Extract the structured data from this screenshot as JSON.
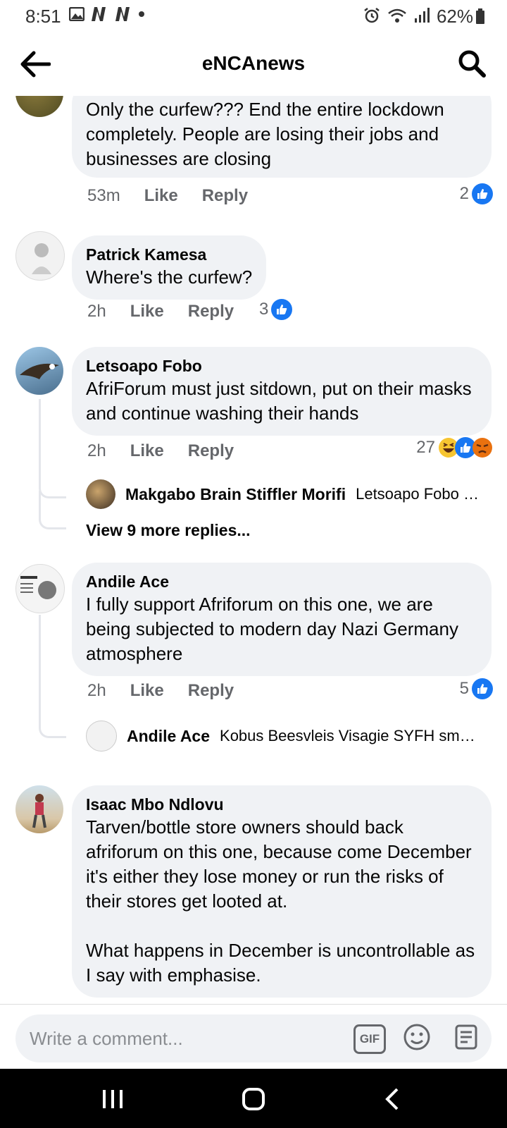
{
  "status_bar": {
    "time": "8:51",
    "battery": "62%"
  },
  "header": {
    "title": "eNCAnews"
  },
  "comments": [
    {
      "author": "",
      "text": "Only the curfew??? End the entire lockdown completely. People are losing their jobs and businesses are closing",
      "time": "53m",
      "like_label": "Like",
      "reply_label": "Reply",
      "reaction_count": "2"
    },
    {
      "author": "Patrick Kamesa",
      "text": "Where's the curfew?",
      "time": "2h",
      "like_label": "Like",
      "reply_label": "Reply",
      "reaction_count": "3"
    },
    {
      "author": "Letsoapo Fobo",
      "text": "AfriForum must just sitdown, put on their masks and continue washing their hands",
      "time": "2h",
      "like_label": "Like",
      "reply_label": "Reply",
      "reaction_count": "27",
      "reply_preview": {
        "author": "Makgabo Brain Stiffler Morifi",
        "text": "Letsoapo Fobo o..."
      },
      "view_more": "View 9 more replies..."
    },
    {
      "author": "Andile Ace",
      "text": "I fully support Afriforum on this one, we are being subjected to modern day Nazi Germany atmosphere",
      "time": "2h",
      "like_label": "Like",
      "reply_label": "Reply",
      "reaction_count": "5",
      "reply_preview": {
        "author": "Andile Ace",
        "text": "Kobus Beesvleis Visagie SYFH smar..."
      }
    },
    {
      "author": "Isaac Mbo Ndlovu",
      "text": "Tarven/bottle store owners should back afriforum on this one, because come December it's either they lose money or run the risks of their stores get looted at.\n\nWhat happens in December is uncontrollable as I say with emphasise."
    }
  ],
  "composer": {
    "placeholder": "Write a comment...",
    "gif_label": "GIF"
  },
  "colors": {
    "accent": "#1877f2",
    "bubble": "#f0f2f5",
    "meta": "#65676b"
  }
}
